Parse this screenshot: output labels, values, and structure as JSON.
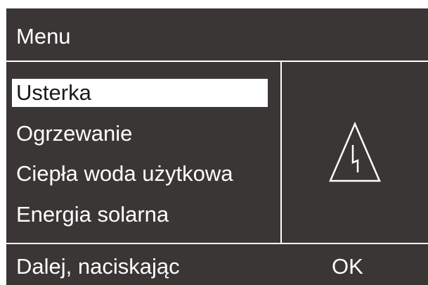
{
  "header": {
    "title": "Menu"
  },
  "menu": {
    "items": [
      {
        "label": "Usterka",
        "selected": true
      },
      {
        "label": "Ogrzewanie",
        "selected": false
      },
      {
        "label": "Ciepła woda użytkowa",
        "selected": false
      },
      {
        "label": "Energia solarna",
        "selected": false
      }
    ]
  },
  "side_panel": {
    "icon": "warning-triangle-lightning-icon"
  },
  "footer": {
    "hint": "Dalej, naciskając",
    "ok_label": "OK"
  },
  "colors": {
    "background": "#3a3635",
    "foreground": "#ffffff",
    "selection_background": "#ffffff",
    "selection_text": "#1c1a19"
  }
}
